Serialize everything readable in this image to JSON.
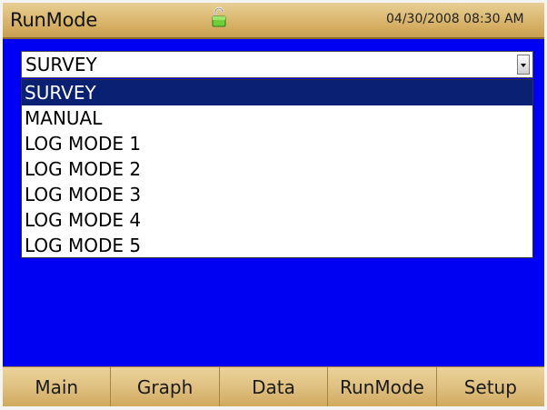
{
  "titlebar": {
    "title": "RunMode",
    "datetime": "04/30/2008 08:30 AM"
  },
  "runmode_select": {
    "selected": "SURVEY",
    "options": [
      "SURVEY",
      "MANUAL",
      "LOG MODE 1",
      "LOG MODE 2",
      "LOG MODE 3",
      "LOG MODE 4",
      "LOG MODE 5"
    ],
    "highlighted_index": 0
  },
  "tabs": [
    "Main",
    "Graph",
    "Data",
    "RunMode",
    "Setup"
  ],
  "colors": {
    "background": "#0000f2",
    "highlight": "#0a2072",
    "bar": "#dfc081"
  },
  "icons": {
    "lock": "unlocked-padlock-icon"
  }
}
